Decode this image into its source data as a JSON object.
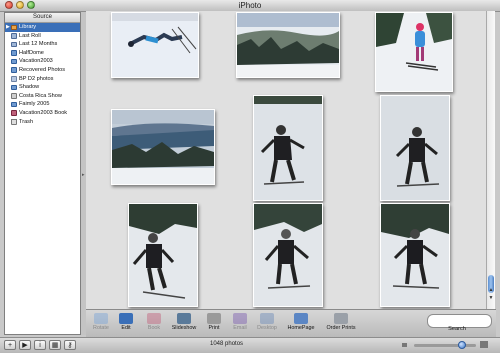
{
  "window": {
    "title": "iPhoto"
  },
  "sidebar": {
    "header": "Source",
    "items": [
      {
        "label": "Library",
        "icon": "library-icon",
        "kind": "lib",
        "selected": true
      },
      {
        "label": "Last Roll",
        "icon": "last-roll-icon",
        "kind": "roll"
      },
      {
        "label": "Last 12 Months",
        "icon": "calendar-icon",
        "kind": "roll"
      },
      {
        "label": "HalfDome",
        "icon": "album-icon",
        "kind": "album"
      },
      {
        "label": "Vacation2003",
        "icon": "album-icon",
        "kind": "album"
      },
      {
        "label": "Recovered Photos",
        "icon": "album-icon",
        "kind": "album"
      },
      {
        "label": "BP D2 photos",
        "icon": "smart-album-icon",
        "kind": "smart"
      },
      {
        "label": "Shadow",
        "icon": "album-icon",
        "kind": "album"
      },
      {
        "label": "Costa Rica Show",
        "icon": "slideshow-icon",
        "kind": "slide"
      },
      {
        "label": "Faimly 2005",
        "icon": "album-icon",
        "kind": "album"
      },
      {
        "label": "Vacation2003 Book",
        "icon": "book-icon",
        "kind": "book"
      },
      {
        "label": "Trash",
        "icon": "trash-icon",
        "kind": "trash"
      }
    ]
  },
  "toolbar": {
    "tools": [
      {
        "label": "Rotate",
        "icon": "rotate-icon",
        "enabled": false,
        "color": "#7aa3d6"
      },
      {
        "label": "Edit",
        "icon": "edit-icon",
        "enabled": true,
        "color": "#3a6fb8"
      },
      {
        "label": "Book",
        "icon": "book-icon",
        "enabled": false,
        "color": "#c0607a"
      },
      {
        "label": "Slideshow",
        "icon": "slideshow-icon",
        "enabled": true,
        "color": "#5a7a9a"
      },
      {
        "label": "Print",
        "icon": "print-icon",
        "enabled": true,
        "color": "#9a9a9a"
      },
      {
        "label": "Email",
        "icon": "email-icon",
        "enabled": false,
        "color": "#7a5ab0"
      },
      {
        "label": "Desktop",
        "icon": "desktop-icon",
        "enabled": false,
        "color": "#6a8ab8"
      },
      {
        "label": "HomePage",
        "icon": "homepage-icon",
        "enabled": true,
        "color": "#5b86c4"
      },
      {
        "label": "Order Prints",
        "icon": "order-prints-icon",
        "enabled": true,
        "color": "#9aa0a8"
      }
    ],
    "search_label": "Search",
    "search_value": ""
  },
  "status": {
    "photo_count": "1048 photos"
  },
  "bottom_buttons": [
    {
      "icon": "add-icon",
      "glyph": "+"
    },
    {
      "icon": "play-icon",
      "glyph": "▶"
    },
    {
      "icon": "info-icon",
      "glyph": "i"
    },
    {
      "icon": "calendar-icon",
      "glyph": "▦"
    },
    {
      "icon": "keywords-icon",
      "glyph": "⚷"
    }
  ],
  "photos": [
    {
      "name": "photo-skier-lying-in-snow",
      "scene": "snow-lying"
    },
    {
      "name": "photo-snowy-forest-valley",
      "scene": "forest"
    },
    {
      "name": "photo-child-skier-blue-jacket",
      "scene": "child"
    },
    {
      "name": "photo-mountain-lake-panorama",
      "scene": "lake"
    },
    {
      "name": "photo-skier-black-jacket-1",
      "scene": "skier"
    },
    {
      "name": "photo-skier-black-jacket-2",
      "scene": "skier"
    },
    {
      "name": "photo-skier-trees-1",
      "scene": "skier-trees"
    },
    {
      "name": "photo-skier-trees-2",
      "scene": "skier-trees"
    },
    {
      "name": "photo-skier-trees-3",
      "scene": "skier-trees"
    }
  ],
  "zoom_level": 0.78
}
